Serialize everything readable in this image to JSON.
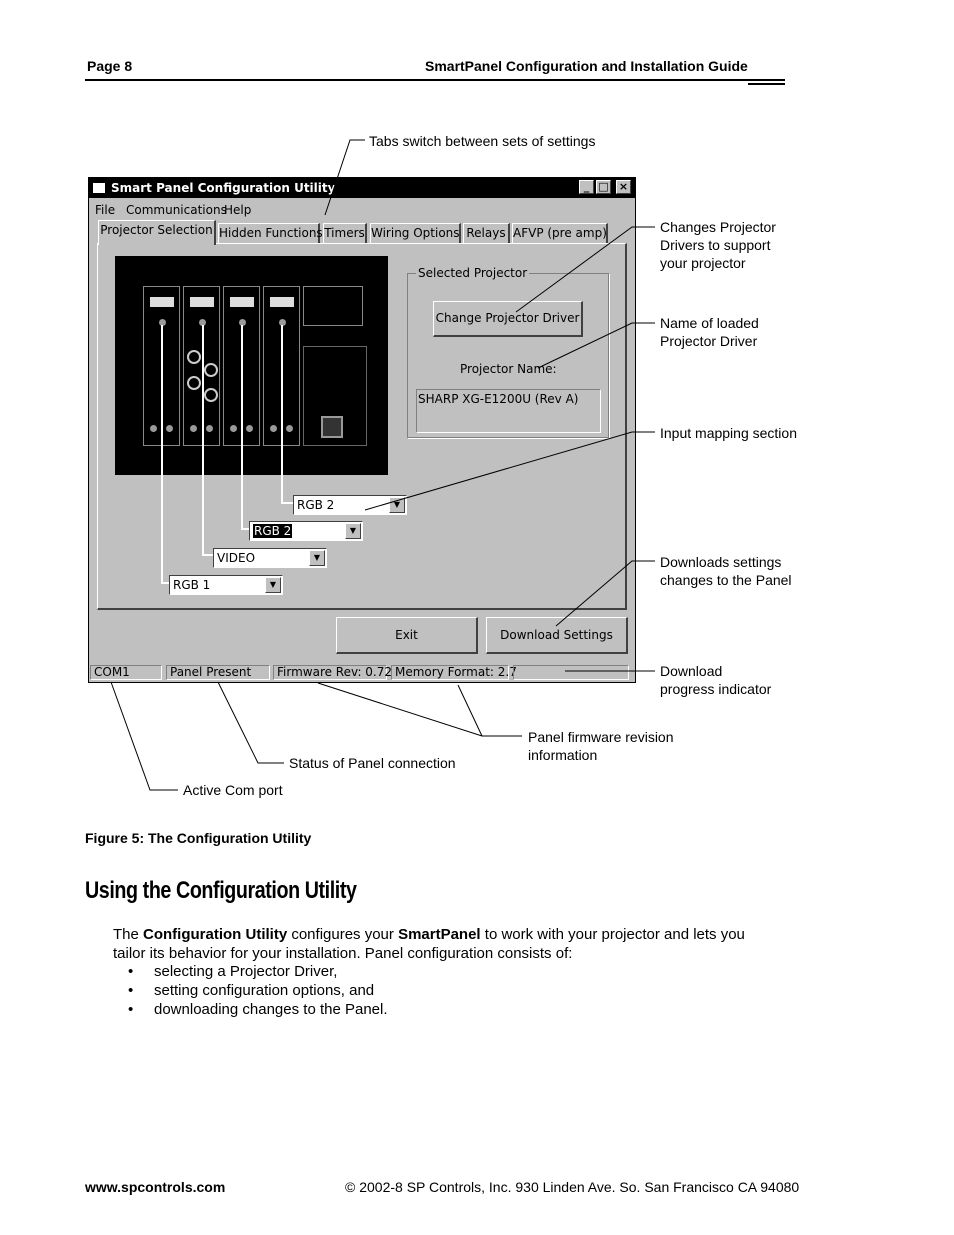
{
  "header": {
    "page": "Page 8",
    "title": "SmartPanel Configuration and Installation Guide"
  },
  "annotations": {
    "tabs": "Tabs switch between sets of settings",
    "change_driver": [
      "Changes Projector",
      "Drivers to support",
      "your projector"
    ],
    "name_driver": [
      "Name of loaded",
      "Projector Driver"
    ],
    "input_mapping": "Input mapping section",
    "downloads": [
      "Downloads settings",
      "changes to the Panel"
    ],
    "progress": [
      "Download",
      "progress indicator"
    ],
    "firmware": [
      "Panel firmware revision",
      "information"
    ],
    "status_panel": "Status of Panel connection",
    "com_port": "Active Com port"
  },
  "window": {
    "title": "Smart Panel Configuration Utility",
    "menu": [
      "File",
      "Communications",
      "Help"
    ],
    "tabs": [
      "Projector Selection",
      "Hidden Functions",
      "Timers",
      "Wiring Options",
      "Relays",
      "AFVP (pre amp)"
    ],
    "group_label": "Selected Projector",
    "change_button": "Change Projector Driver",
    "projector_name_label": "Projector Name:",
    "projector_name_value": "SHARP XG-E1200U (Rev A)",
    "inputs": [
      "RGB 2",
      "RGB 2",
      "VIDEO",
      "RGB 1"
    ],
    "exit_button": "Exit",
    "download_button": "Download Settings",
    "status": [
      "COM1",
      "Panel Present",
      "Firmware Rev: 0.72",
      "Memory Format: 2.7"
    ]
  },
  "caption": "Figure 5: The Configuration Utility",
  "section": {
    "heading": "Using the Configuration Utility",
    "p_before1": "The ",
    "b1": "Configuration Utility",
    "p_mid": " configures your ",
    "b2": "SmartPanel",
    "p_after": " to work with your projector and lets you",
    "p_line2": "tailor its behavior for your installation. Panel configuration consists of:",
    "bullets": [
      "selecting a Projector Driver,",
      "setting configuration options, and",
      "downloading changes to the Panel."
    ]
  },
  "footer": {
    "left": "www.spcontrols.com",
    "right": "© 2002-8 SP Controls, Inc. 930 Linden Ave. So. San Francisco CA 94080"
  }
}
